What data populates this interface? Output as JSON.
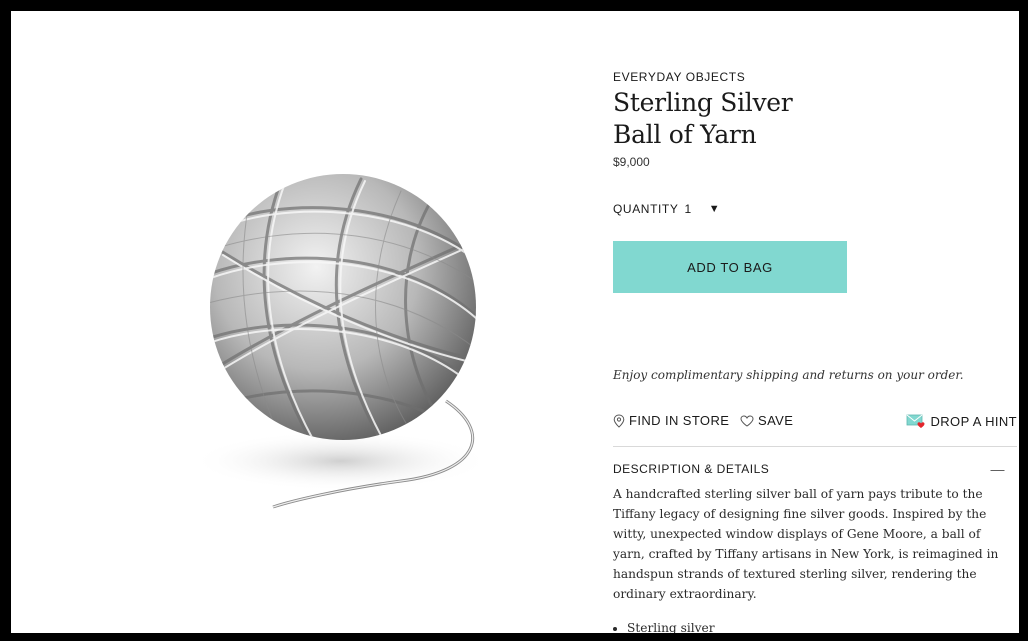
{
  "product": {
    "category": "EVERYDAY OBJECTS",
    "title_line1": "Sterling Silver",
    "title_line2": "Ball of Yarn",
    "price": "$9,000"
  },
  "purchase": {
    "quantity_label": "QUANTITY",
    "quantity_value": "1",
    "add_to_bag_label": "ADD TO BAG",
    "button_color": "#81d8d0"
  },
  "shipping_note": "Enjoy complimentary shipping and returns on your order.",
  "actions": {
    "find_in_store": "FIND IN STORE",
    "save": "SAVE",
    "drop_a_hint": "DROP A HINT"
  },
  "description": {
    "header": "DESCRIPTION & DETAILS",
    "collapse_symbol": "—",
    "body": "A handcrafted sterling silver ball of yarn pays tribute to the Tiffany legacy of designing fine silver goods. Inspired by the witty, unexpected window displays of Gene Moore, a ball of yarn, crafted by Tiffany artisans in New York, is reimagined in handspun strands of textured sterling silver, rendering the ordinary extraordinary.",
    "bullets": [
      "Sterling silver"
    ]
  },
  "icons": {
    "location": "map-pin-icon",
    "save": "heart-outline-icon",
    "hint": "envelope-heart-icon"
  }
}
